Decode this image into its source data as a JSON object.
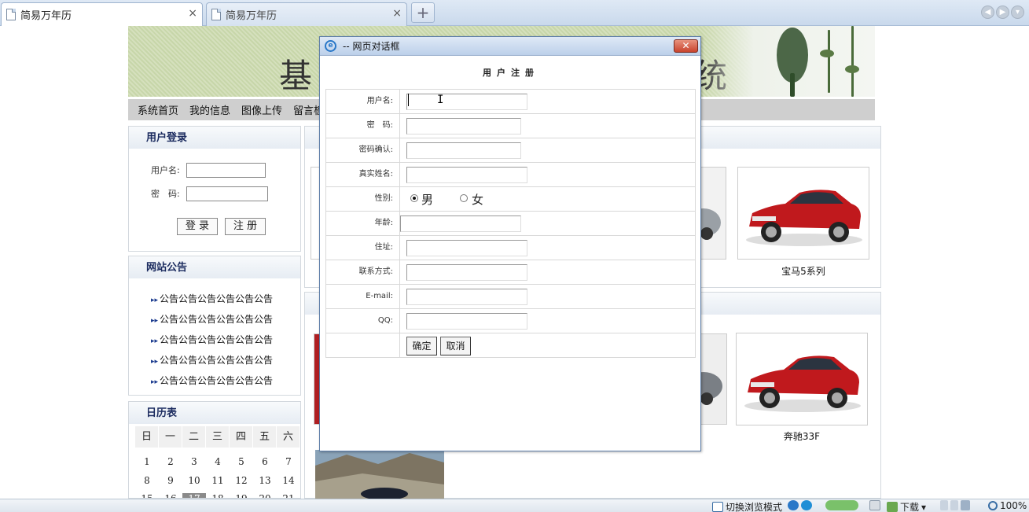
{
  "browser": {
    "tabs": [
      {
        "title": "简易万年历",
        "active": true
      },
      {
        "title": "简易万年历",
        "active": false
      }
    ],
    "close_glyph": "×",
    "new_tab_glyph": "+"
  },
  "banner": {
    "title_left": "基",
    "title_right": "统"
  },
  "menu": [
    "系统首页",
    "我的信息",
    "图像上传",
    "留言板"
  ],
  "login_panel": {
    "title": "用户登录",
    "username_label": "用户名:",
    "password_label": "密　码:",
    "login_button": "登 录",
    "register_button": "注 册"
  },
  "notice_panel": {
    "title": "网站公告",
    "items": [
      "公告公告公告公告公告公告",
      "公告公告公告公告公告公告",
      "公告公告公告公告公告公告",
      "公告公告公告公告公告公告",
      "公告公告公告公告公告公告"
    ]
  },
  "calendar_panel": {
    "title": "日历表",
    "weekdays": [
      "日",
      "一",
      "二",
      "三",
      "四",
      "五",
      "六"
    ],
    "rows": [
      [
        "1",
        "2",
        "3",
        "4",
        "5",
        "6",
        "7"
      ],
      [
        "8",
        "9",
        "10",
        "11",
        "12",
        "13",
        "14"
      ],
      [
        "15",
        "16",
        "17",
        "18",
        "19",
        "20",
        "21"
      ]
    ],
    "today": "17"
  },
  "products": [
    {
      "caption": "宝马5系列"
    },
    {
      "caption": "奔驰33F"
    }
  ],
  "dialog": {
    "title": "-- 网页对话框",
    "close_glyph": "✕",
    "heading": "用户注册",
    "fields": [
      {
        "label": "用户名:",
        "value": ""
      },
      {
        "label": "密　码:",
        "value": ""
      },
      {
        "label": "密码确认:",
        "value": ""
      },
      {
        "label": "真实姓名:",
        "value": ""
      },
      {
        "label": "性别:",
        "value": ""
      },
      {
        "label": "年龄:",
        "value": ""
      },
      {
        "label": "住址:",
        "value": ""
      },
      {
        "label": "联系方式:",
        "value": ""
      },
      {
        "label": "E-mail:",
        "value": ""
      },
      {
        "label": "QQ:",
        "value": ""
      }
    ],
    "gender_options": [
      "男",
      "女"
    ],
    "gender_selected": "男",
    "confirm_button": "确定",
    "cancel_button": "取消"
  },
  "statusbar": {
    "switch_mode": "切换浏览模式",
    "download": "下载",
    "zoom": "100%"
  }
}
